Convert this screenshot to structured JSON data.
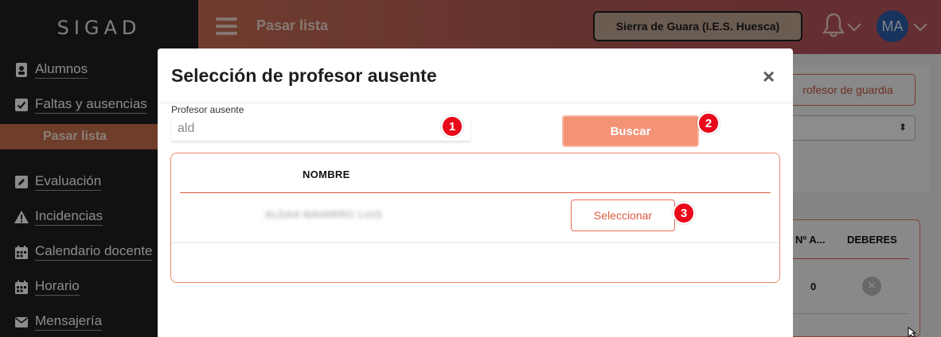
{
  "app": {
    "brand": "SIGAD"
  },
  "sidebar": {
    "items": [
      {
        "label": "Alumnos",
        "icon": "address-book-icon"
      },
      {
        "label": "Faltas y ausencias",
        "icon": "check-square-icon"
      },
      {
        "label": "Pasar lista",
        "icon": ""
      },
      {
        "label": "Evaluación",
        "icon": "edit-icon"
      },
      {
        "label": "Incidencias",
        "icon": "warning-icon"
      },
      {
        "label": "Calendario docente",
        "icon": "calendar-icon"
      },
      {
        "label": "Horario",
        "icon": "calendar-icon"
      },
      {
        "label": "Mensajería",
        "icon": "envelope-icon"
      }
    ]
  },
  "header": {
    "title": "Pasar lista",
    "center": "Sierra de Guara (I.E.S. Huesca)",
    "avatar": "MA"
  },
  "background": {
    "guardia_button": "rofesor de guardia",
    "columns": [
      "Nº A...",
      "DEBERES"
    ],
    "row_value": "0"
  },
  "modal": {
    "title": "Selección de profesor ausente",
    "close": "×",
    "field_label": "Profesor ausente",
    "field_value": "ald",
    "search_button": "Buscar",
    "column_name": "NOMBRE",
    "row_name_blurred": "ALDAA NAVARRO LUIS",
    "select_button": "Seleccionar",
    "badges": [
      "1",
      "2",
      "3"
    ]
  },
  "colors": {
    "accent": "#f49276",
    "badge": "#e8091a",
    "sidebar": "#1f1f24"
  }
}
